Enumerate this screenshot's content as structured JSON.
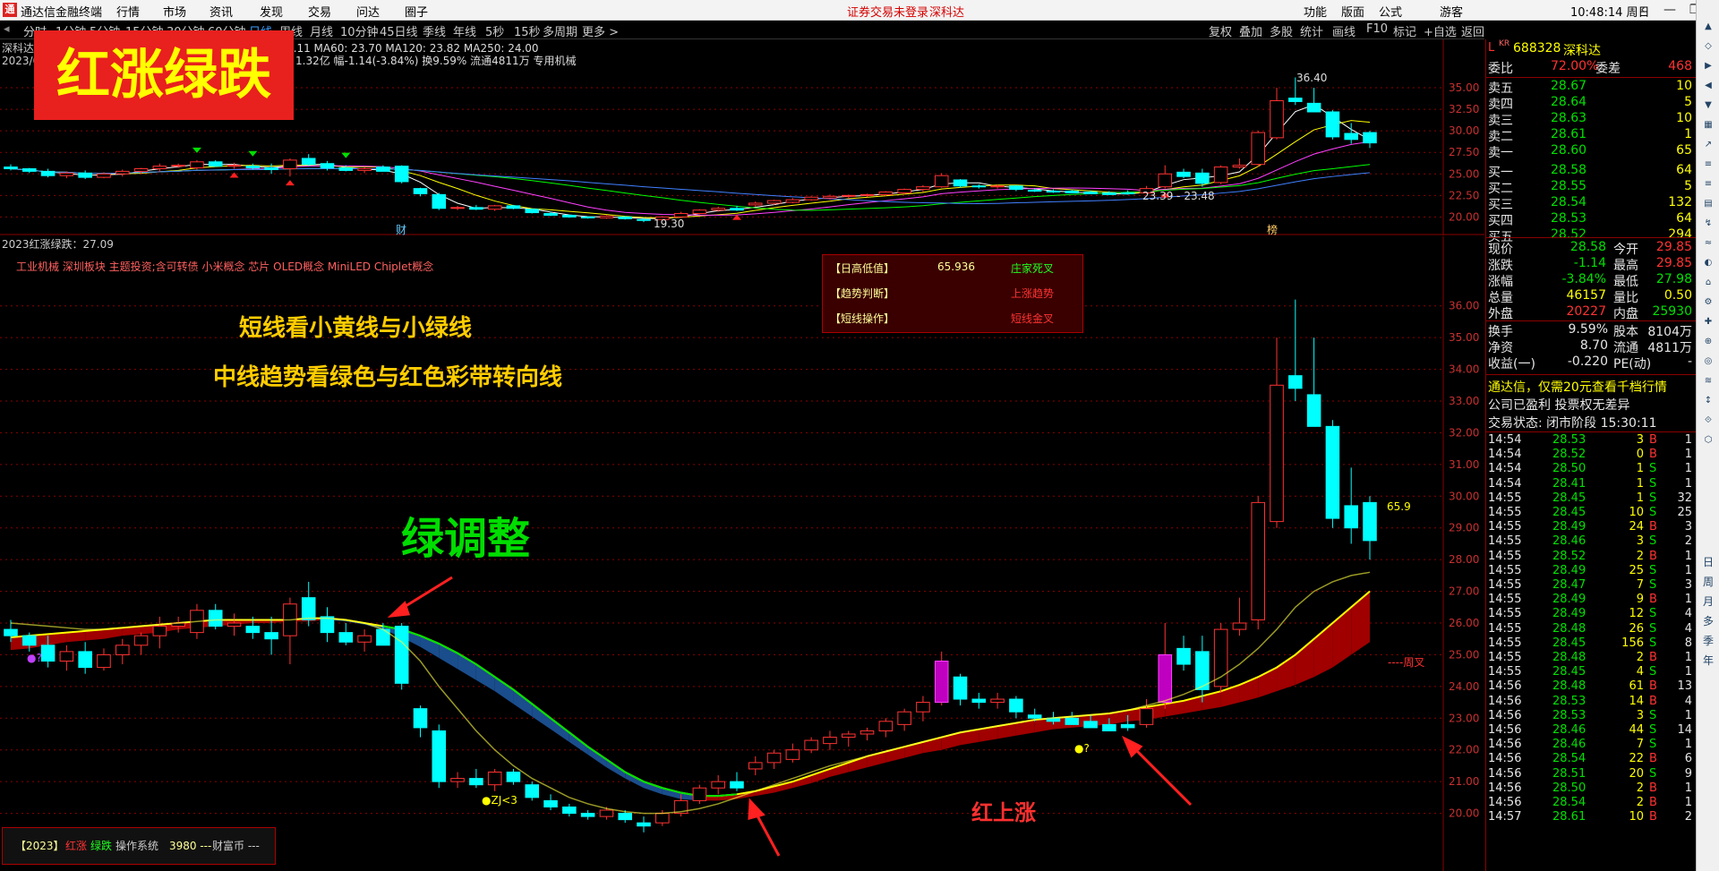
{
  "window": {
    "app_title": "通达信金融终端",
    "menu": [
      "行情",
      "市场",
      "资讯",
      "发现",
      "交易",
      "问达",
      "圈子"
    ],
    "notice": "证券交易未登录",
    "stock_short": "深科达",
    "right_menu": [
      "功能",
      "版面",
      "公式",
      "游客"
    ],
    "clock": "10:48:14 周日"
  },
  "periods": [
    "分时",
    "1分钟",
    "5分钟",
    "15分钟",
    "30分钟",
    "60分钟",
    "日线",
    "周线",
    "月线",
    "10分钟",
    "45日线",
    "季线",
    "年线",
    "5秒",
    "15秒",
    "多周期",
    "更多 >"
  ],
  "selected_period": "日线",
  "tools": [
    "复权",
    "叠加",
    "多股",
    "统计",
    "画线",
    "F10",
    "标记",
    "+自选",
    "返回"
  ],
  "upper_chart": {
    "title_code": "深科达",
    "date": "2023/0",
    "ma_line": "6.11  MA60: 23.70  MA120: 23.82  MA250: 24.00",
    "info_line": "1.32亿 幅-1.14(-3.84%) 换9.59% 流通4811万 专用机械",
    "y_ticks": [
      "35.00",
      "32.50",
      "30.00",
      "27.50",
      "25.00",
      "22.50",
      "20.00"
    ],
    "high_label": "36.40",
    "low_label": "19.30",
    "range_label": "23.39 - 23.48",
    "tag_cai": "财",
    "tag_bang": "榜"
  },
  "banner": {
    "text": "红涨绿跌"
  },
  "lower_chart": {
    "indicator_title": "2023红涨绿跌：27.09",
    "concepts": "工业机械 深圳板块 主题投资;含可转债 小米概念 芯片 OLED概念 MiniLED Chiplet概念",
    "headline1": "短线看小黄线与小绿线",
    "headline2": "中线趋势看绿色与红色彩带转向线",
    "label_green": "绿调整",
    "label_red": "红上涨",
    "marker_zj": "●ZJ<3",
    "marker_q1": "●?",
    "marker_q2": "●?",
    "price_tag": "65.9",
    "zhoucha": "----周叉",
    "y_ticks": [
      "36.00",
      "35.00",
      "34.00",
      "33.00",
      "32.00",
      "31.00",
      "30.00",
      "29.00",
      "28.00",
      "27.00",
      "26.00",
      "25.00",
      "24.00",
      "23.00",
      "22.00",
      "21.00",
      "20.00"
    ],
    "info_box": [
      {
        "label": "【日高低值】",
        "value": "65.936",
        "status": "庄家死叉"
      },
      {
        "label": "【趋势判断】",
        "value": "",
        "status": "上涨趋势"
      },
      {
        "label": "【短线操作】",
        "value": "",
        "status": "短线金叉"
      }
    ],
    "footer_box": {
      "prefix": "【2023】",
      "red_word": "红涨",
      "green_word": "绿跌",
      "rest": "操作系统",
      "price": "3980 ---",
      "tail": "财富币 ---"
    }
  },
  "quote": {
    "code_prefix": "L",
    "code_tag": "KR",
    "code": "688328",
    "name": "深科达",
    "weibi_label": "委比",
    "weibi": "72.00%",
    "weicha_label": "委差",
    "weicha": "468",
    "sells": [
      {
        "label": "卖五",
        "price": "28.67",
        "vol": "10"
      },
      {
        "label": "卖四",
        "price": "28.64",
        "vol": "5"
      },
      {
        "label": "卖三",
        "price": "28.63",
        "vol": "10"
      },
      {
        "label": "卖二",
        "price": "28.61",
        "vol": "1"
      },
      {
        "label": "卖一",
        "price": "28.60",
        "vol": "65"
      }
    ],
    "buys": [
      {
        "label": "买一",
        "price": "28.58",
        "vol": "64"
      },
      {
        "label": "买二",
        "price": "28.55",
        "vol": "5"
      },
      {
        "label": "买三",
        "price": "28.54",
        "vol": "132"
      },
      {
        "label": "买四",
        "price": "28.53",
        "vol": "64"
      },
      {
        "label": "买五",
        "price": "28.52",
        "vol": "294"
      }
    ],
    "stats": [
      {
        "l1": "现价",
        "v1": "28.58",
        "l2": "今开",
        "v2": "29.85"
      },
      {
        "l1": "涨跌",
        "v1": "-1.14",
        "l2": "最高",
        "v2": "29.85"
      },
      {
        "l1": "涨幅",
        "v1": "-3.84%",
        "l2": "最低",
        "v2": "27.98"
      },
      {
        "l1": "总量",
        "v1": "46157",
        "l2": "量比",
        "v2": "0.50"
      },
      {
        "l1": "外盘",
        "v1": "20227",
        "l2": "内盘",
        "v2": "25930"
      }
    ],
    "stats2": [
      {
        "l1": "换手",
        "v1": "9.59%",
        "l2": "股本",
        "v2": "8104万"
      },
      {
        "l1": "净资",
        "v1": "8.70",
        "l2": "流通",
        "v2": "4811万"
      },
      {
        "l1": "收益(一)",
        "v1": "-0.220",
        "l2": "PE(动)",
        "v2": "-"
      }
    ],
    "promo": "通达信，仅需20元查看千档行情",
    "company_note": "公司已盈利 投票权无差异",
    "trade_state": "交易状态: 闭市阶段 15:30:11",
    "ticks": [
      [
        "14:54",
        "28.53",
        "3",
        "B",
        "1"
      ],
      [
        "14:54",
        "28.52",
        "0",
        "B",
        "1"
      ],
      [
        "14:54",
        "28.50",
        "1",
        "S",
        "1"
      ],
      [
        "14:54",
        "28.41",
        "1",
        "S",
        "1"
      ],
      [
        "14:55",
        "28.45",
        "1",
        "S",
        "32"
      ],
      [
        "14:55",
        "28.45",
        "10",
        "S",
        "25"
      ],
      [
        "14:55",
        "28.49",
        "24",
        "B",
        "3"
      ],
      [
        "14:55",
        "28.46",
        "3",
        "S",
        "2"
      ],
      [
        "14:55",
        "28.52",
        "2",
        "B",
        "1"
      ],
      [
        "14:55",
        "28.49",
        "25",
        "S",
        "1"
      ],
      [
        "14:55",
        "28.47",
        "7",
        "S",
        "3"
      ],
      [
        "14:55",
        "28.49",
        "9",
        "B",
        "1"
      ],
      [
        "14:55",
        "28.49",
        "12",
        "S",
        "4"
      ],
      [
        "14:55",
        "28.48",
        "26",
        "S",
        "4"
      ],
      [
        "14:55",
        "28.45",
        "156",
        "S",
        "8"
      ],
      [
        "14:55",
        "28.48",
        "2",
        "B",
        "1"
      ],
      [
        "14:55",
        "28.45",
        "4",
        "S",
        "1"
      ],
      [
        "14:56",
        "28.48",
        "61",
        "B",
        "13"
      ],
      [
        "14:56",
        "28.53",
        "14",
        "B",
        "4"
      ],
      [
        "14:56",
        "28.53",
        "3",
        "S",
        "1"
      ],
      [
        "14:56",
        "28.46",
        "44",
        "S",
        "14"
      ],
      [
        "14:56",
        "28.46",
        "7",
        "S",
        "1"
      ],
      [
        "14:56",
        "28.54",
        "22",
        "B",
        "6"
      ],
      [
        "14:56",
        "28.51",
        "20",
        "S",
        "9"
      ],
      [
        "14:56",
        "28.50",
        "2",
        "B",
        "1"
      ],
      [
        "14:56",
        "28.54",
        "2",
        "B",
        "1"
      ],
      [
        "14:57",
        "28.61",
        "10",
        "B",
        "2"
      ]
    ]
  },
  "side_tools": [
    "日",
    "周",
    "月",
    "多",
    "季",
    "年"
  ],
  "colors": {
    "up": "#ff3232",
    "down": "#00ffff",
    "grid": "#8b0000",
    "ribbon_down": "#1a4d8c",
    "ribbon_up": "#a00000"
  },
  "chart_data": [
    {
      "type": "candlestick",
      "title": "2023红涨绿跌：27.09",
      "ylim": [
        19.5,
        36.5
      ],
      "ohlc": [
        [
          25.8,
          26.1,
          25.4,
          25.6
        ],
        [
          25.6,
          25.7,
          25.1,
          25.3
        ],
        [
          25.3,
          25.6,
          24.6,
          24.8
        ],
        [
          24.8,
          25.3,
          24.5,
          25.1
        ],
        [
          25.1,
          25.4,
          24.4,
          24.6
        ],
        [
          24.6,
          25.2,
          24.5,
          25.0
        ],
        [
          25.0,
          25.5,
          24.7,
          25.3
        ],
        [
          25.3,
          25.7,
          25.0,
          25.6
        ],
        [
          25.6,
          26.2,
          25.2,
          25.9
        ],
        [
          25.9,
          26.2,
          25.7,
          26.0
        ],
        [
          25.7,
          26.6,
          25.5,
          26.4
        ],
        [
          26.4,
          26.6,
          25.8,
          25.9
        ],
        [
          25.9,
          26.3,
          25.6,
          26.0
        ],
        [
          25.9,
          26.2,
          25.5,
          25.7
        ],
        [
          25.7,
          26.2,
          25.0,
          25.5
        ],
        [
          25.6,
          26.8,
          24.7,
          26.6
        ],
        [
          26.8,
          27.3,
          25.9,
          26.1
        ],
        [
          26.2,
          26.5,
          25.4,
          25.7
        ],
        [
          25.7,
          26.0,
          25.3,
          25.4
        ],
        [
          25.4,
          25.8,
          25.1,
          25.6
        ],
        [
          25.8,
          26.0,
          25.4,
          25.3
        ],
        [
          25.9,
          26.0,
          23.9,
          24.1
        ],
        [
          23.3,
          23.4,
          22.4,
          22.7
        ],
        [
          22.6,
          22.8,
          20.8,
          21.0
        ],
        [
          21.0,
          21.3,
          20.8,
          21.1
        ],
        [
          21.1,
          21.4,
          20.8,
          20.9
        ],
        [
          20.9,
          21.4,
          20.7,
          21.3
        ],
        [
          21.3,
          21.4,
          20.9,
          21.0
        ],
        [
          20.9,
          21.0,
          20.4,
          20.5
        ],
        [
          20.4,
          20.6,
          20.1,
          20.2
        ],
        [
          20.2,
          20.3,
          19.9,
          20.0
        ],
        [
          20.0,
          20.1,
          19.8,
          19.9
        ],
        [
          19.9,
          20.2,
          19.8,
          20.1
        ],
        [
          20.0,
          20.1,
          19.7,
          19.8
        ],
        [
          19.7,
          19.9,
          19.4,
          19.6
        ],
        [
          19.7,
          20.1,
          19.6,
          20.0
        ],
        [
          20.0,
          20.6,
          19.9,
          20.4
        ],
        [
          20.4,
          20.9,
          20.3,
          20.8
        ],
        [
          20.8,
          21.2,
          20.6,
          21.0
        ],
        [
          21.0,
          21.3,
          20.7,
          20.8
        ],
        [
          21.4,
          21.8,
          21.2,
          21.6
        ],
        [
          21.6,
          22.0,
          21.4,
          21.9
        ],
        [
          21.7,
          22.2,
          21.6,
          22.0
        ],
        [
          22.0,
          22.4,
          21.9,
          22.3
        ],
        [
          22.2,
          22.6,
          22.0,
          22.4
        ],
        [
          22.4,
          22.6,
          22.1,
          22.5
        ],
        [
          22.5,
          22.7,
          22.3,
          22.6
        ],
        [
          22.6,
          23.0,
          22.4,
          22.9
        ],
        [
          22.8,
          23.3,
          22.6,
          23.2
        ],
        [
          23.2,
          23.7,
          22.9,
          23.5
        ],
        [
          23.5,
          25.1,
          23.4,
          24.8
        ],
        [
          24.3,
          24.4,
          23.4,
          23.6
        ],
        [
          23.6,
          23.8,
          23.3,
          23.5
        ],
        [
          23.5,
          23.8,
          23.3,
          23.6
        ],
        [
          23.6,
          23.7,
          23.0,
          23.2
        ],
        [
          23.1,
          23.3,
          22.9,
          23.0
        ],
        [
          23.0,
          23.2,
          22.8,
          22.9
        ],
        [
          23.0,
          23.2,
          22.8,
          22.8
        ],
        [
          22.9,
          23.1,
          22.7,
          22.7
        ],
        [
          22.8,
          23.0,
          22.6,
          22.6
        ],
        [
          22.8,
          23.1,
          22.6,
          22.7
        ],
        [
          22.8,
          23.6,
          22.7,
          23.3
        ],
        [
          23.5,
          26.0,
          23.3,
          25.0
        ],
        [
          25.2,
          25.6,
          24.5,
          24.7
        ],
        [
          25.1,
          25.6,
          23.5,
          23.9
        ],
        [
          24.0,
          26.0,
          23.8,
          25.8
        ],
        [
          25.8,
          26.8,
          25.6,
          26.0
        ],
        [
          26.1,
          30.0,
          25.8,
          29.8
        ],
        [
          29.2,
          35.0,
          29.0,
          33.5
        ],
        [
          33.8,
          36.2,
          33.0,
          33.4
        ],
        [
          33.2,
          35.0,
          32.2,
          32.2
        ],
        [
          32.2,
          32.4,
          29.0,
          29.3
        ],
        [
          29.7,
          30.9,
          28.5,
          29.0
        ],
        [
          29.8,
          30.0,
          28.0,
          28.6
        ]
      ],
      "short_line": [
        26.0,
        25.95,
        25.9,
        25.85,
        25.8,
        25.8,
        25.85,
        25.9,
        25.95,
        26.0,
        26.05,
        26.1,
        26.1,
        26.1,
        26.1,
        26.1,
        26.15,
        26.15,
        26.1,
        26.0,
        25.8,
        25.4,
        24.8,
        24.0,
        23.3,
        22.6,
        22.0,
        21.5,
        21.1,
        20.8,
        20.5,
        20.3,
        20.15,
        20.05,
        20.0,
        20.0,
        20.05,
        20.15,
        20.3,
        20.5,
        20.7,
        20.9,
        21.1,
        21.3,
        21.5,
        21.65,
        21.8,
        21.95,
        22.1,
        22.25,
        22.4,
        22.55,
        22.65,
        22.75,
        22.85,
        22.95,
        23.0,
        23.05,
        23.1,
        23.15,
        23.25,
        23.4,
        23.55,
        23.75,
        24.0,
        24.3,
        24.7,
        25.2,
        25.8,
        26.5,
        27.0,
        27.3,
        27.5,
        27.6
      ],
      "ribbon_fast": [
        25.55,
        25.6,
        25.65,
        25.7,
        25.75,
        25.8,
        25.85,
        25.9,
        25.95,
        26.0,
        26.05,
        26.1,
        26.1,
        26.1,
        26.1,
        26.1,
        26.15,
        26.15,
        26.1,
        26.0,
        25.9,
        25.8,
        25.6,
        25.35,
        25.05,
        24.7,
        24.3,
        23.9,
        23.45,
        23.0,
        22.55,
        22.1,
        21.7,
        21.3,
        21.0,
        20.8,
        20.65,
        20.55,
        20.55,
        20.6,
        20.7,
        20.85,
        21.0,
        21.2,
        21.4,
        21.6,
        21.8,
        21.95,
        22.1,
        22.25,
        22.4,
        22.55,
        22.65,
        22.75,
        22.85,
        22.95,
        23.0,
        23.05,
        23.1,
        23.15,
        23.25,
        23.35,
        23.45,
        23.55,
        23.7,
        23.85,
        24.05,
        24.3,
        24.6,
        25.0,
        25.5,
        26.0,
        26.5,
        27.0
      ],
      "ribbon_slow": [
        25.15,
        25.2,
        25.3,
        25.4,
        25.45,
        25.5,
        25.6,
        25.65,
        25.7,
        25.8,
        25.85,
        25.9,
        25.95,
        26.0,
        26.0,
        26.05,
        26.05,
        26.1,
        26.05,
        25.95,
        25.8,
        25.55,
        25.25,
        24.9,
        24.55,
        24.2,
        23.85,
        23.45,
        23.05,
        22.65,
        22.25,
        21.85,
        21.45,
        21.1,
        20.8,
        20.6,
        20.45,
        20.4,
        20.4,
        20.45,
        20.55,
        20.65,
        20.8,
        20.95,
        21.15,
        21.3,
        21.45,
        21.6,
        21.75,
        21.9,
        22.0,
        22.15,
        22.25,
        22.35,
        22.45,
        22.55,
        22.65,
        22.7,
        22.75,
        22.8,
        22.9,
        22.95,
        23.05,
        23.15,
        23.25,
        23.35,
        23.5,
        23.65,
        23.85,
        24.05,
        24.3,
        24.6,
        25.0,
        25.4
      ]
    }
  ]
}
